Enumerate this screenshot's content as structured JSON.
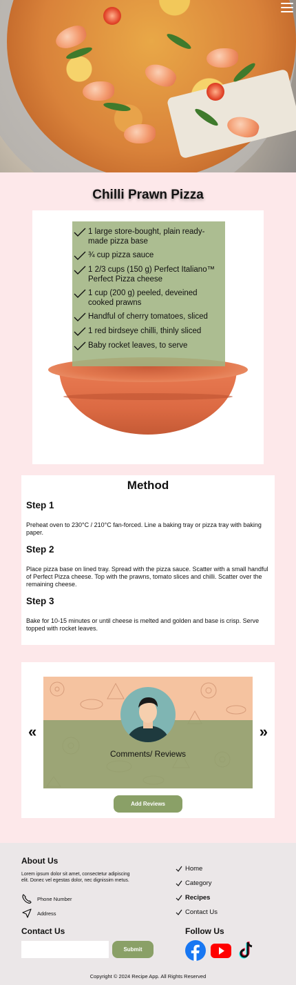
{
  "hero": {
    "image_alt": "Chilli prawn pizza on a tray"
  },
  "recipe": {
    "title": "Chilli Prawn Pizza"
  },
  "ingredients": [
    "1 large store-bought, plain ready-made pizza base",
    "¾ cup pizza sauce",
    "1 2/3 cups (150 g) Perfect Italiano™ Perfect Pizza cheese",
    "1 cup (200 g) peeled, deveined cooked prawns",
    "Handful of cherry tomatoes, sliced",
    "1 red birdseye chilli, thinly sliced",
    "Baby rocket leaves, to serve"
  ],
  "method": {
    "heading": "Method",
    "steps": [
      {
        "title": "Step 1",
        "text": "Preheat oven to 230°C / 210°C fan-forced. Line a baking tray or pizza tray with baking paper."
      },
      {
        "title": "Step 2",
        "text": "Place pizza base on lined tray. Spread with the pizza sauce. Scatter with a small handful of Perfect Pizza cheese. Top with the prawns, tomato slices and chilli. Scatter over the remaining cheese."
      },
      {
        "title": "Step 3",
        "text": "Bake for 10-15 minutes or until cheese is melted and golden and base is crisp. Serve topped with rocket leaves."
      }
    ]
  },
  "reviews": {
    "slide_label": "Comments/ Reviews",
    "prev_arrow": "«",
    "next_arrow": "»",
    "add_button": "Add Reviews"
  },
  "footer": {
    "about_heading": "About Us",
    "about_text": "Lorem ipsum dolor sit amet, consectetur adipiscing elit. Donec vel egestas dolor, nec dignissim metus.",
    "phone_label": "Phone Number",
    "address_label": "Address",
    "links": [
      "Home",
      "Category",
      "Recipes",
      "Contact Us"
    ],
    "contact_heading": "Contact Us",
    "contact_placeholder": "",
    "submit_label": "Submit",
    "follow_heading": "Follow Us",
    "copyright": "Copyright © 2024 Recipe App. All Rights Reserved"
  },
  "icons": {
    "menu": "hamburger-menu-icon",
    "check": "checkmark-icon",
    "phone": "phone-icon",
    "address": "send-location-icon",
    "facebook": "facebook-icon",
    "youtube": "youtube-icon",
    "tiktok": "tiktok-icon"
  },
  "colors": {
    "page_bg": "#fde8ea",
    "accent_green": "#8aa067",
    "ingredient_panel": "#a0b482",
    "footer_bg": "#ebe7e8",
    "facebook": "#1877f2",
    "youtube": "#ff0000"
  }
}
